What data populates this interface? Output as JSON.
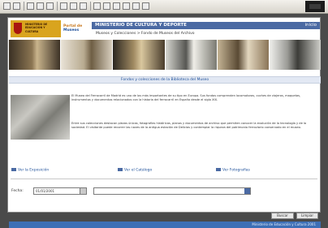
{
  "header": {
    "logo_text": "MINISTERIO DE EDUCACIÓN Y CULTURA",
    "portal_line1": "Portal de",
    "portal_line2": "Museos",
    "bar_title": "MINISTERIO DE CULTURA Y DEPORTE",
    "bar_right": "inicio",
    "breadcrumb": "Museos y Colecciones > Fondo de Museos del Archivo"
  },
  "section": {
    "title": "Fondos y colecciones de la Biblioteca del Museo"
  },
  "content": {
    "paragraph1": "El Museo del Ferrocarril de Madrid es uno de los más importantes de su tipo en Europa. Sus fondos comprenden locomotoras, coches de viajeros, maquetas, instrumentos y documentos relacionados con la historia del ferrocarril en España desde el siglo XIX.",
    "paragraph2": "Entre sus colecciones destacan piezas únicas, fotografías históricas, planos y documentos de archivo que permiten conocer la evolución de la tecnología y de la sociedad. El visitante puede recorrer las naves de la antigua estación de Delicias y contemplar la riqueza del patrimonio ferroviario conservado en el museo."
  },
  "links": [
    {
      "label": "Ver la Exposición",
      "icon": "eye-icon"
    },
    {
      "label": "Ver el Catálogo",
      "icon": "book-icon"
    },
    {
      "label": "Ver Fotografías",
      "icon": "camera-icon"
    }
  ],
  "form": {
    "label": "Fecha:",
    "date_value": "01/01/2001",
    "select_value": ""
  },
  "buttons": {
    "search": "Buscar",
    "clear": "Limpiar"
  },
  "footer": {
    "text": "Ministerio de Educación y Cultura 2001"
  },
  "colors": {
    "bar": "#4b6aa3",
    "footer": "#3d6fb6",
    "logo_yellow": "#d9a41e",
    "shield_red": "#a8140f"
  }
}
